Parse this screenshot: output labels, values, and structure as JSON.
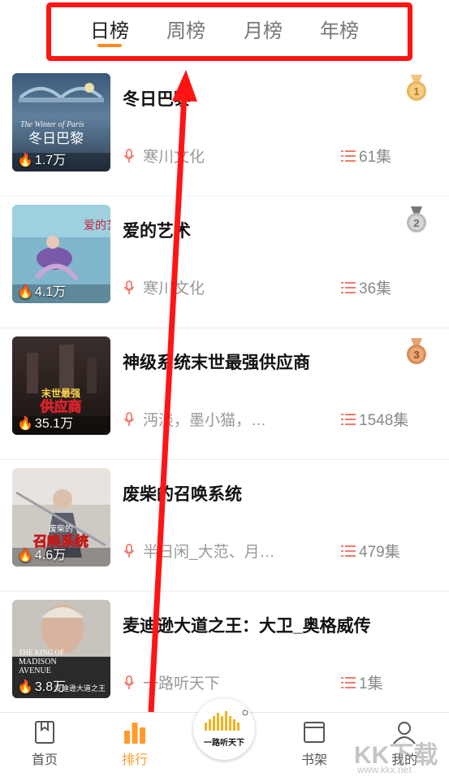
{
  "tabs": [
    {
      "label": "日榜",
      "active": true
    },
    {
      "label": "周榜",
      "active": false
    },
    {
      "label": "月榜",
      "active": false
    },
    {
      "label": "年榜",
      "active": false
    }
  ],
  "items": [
    {
      "title": "冬日巴黎",
      "author": "寒川文化",
      "episodes": "61集",
      "plays": "1.7万",
      "medal": "1",
      "cover_text": [
        "The Winter of Paris",
        "冬日巴黎"
      ]
    },
    {
      "title": "爱的艺术",
      "author": "寒川文化",
      "episodes": "36集",
      "plays": "4.1万",
      "medal": "2",
      "cover_text": [
        "爱的艺术"
      ]
    },
    {
      "title": "神级系统末世最强供应商",
      "author": "沔淡，墨小猫，…",
      "episodes": "1548集",
      "plays": "35.1万",
      "medal": "3",
      "cover_text": [
        "末世最强",
        "供应商"
      ]
    },
    {
      "title": "废柴的召唤系统",
      "author": "半日闲_大范、月…",
      "episodes": "479集",
      "plays": "4.6万",
      "medal": "",
      "cover_text": [
        "废柴的",
        "召唤系统"
      ]
    },
    {
      "title": "麦迪逊大道之王：大卫_奥格威传",
      "author": "一路听天下",
      "episodes": "1集",
      "plays": "3.8万",
      "medal": "",
      "cover_text": [
        "THE KING OF",
        "MADISON",
        "AVENUE",
        "麦迪逊大道之王"
      ]
    }
  ],
  "bottom_nav": {
    "home": "首页",
    "rank": "排行",
    "center_logo": "一路听天下",
    "shelf": "书架",
    "mine": "我的"
  },
  "watermark": {
    "big": "KK下载",
    "small": "www.kkx.net"
  },
  "colors": {
    "accent": "#ff8a1f",
    "annotation": "#ff1414",
    "gold": "#e9b45a",
    "silver": "#b9b9b9",
    "bronze": "#d98b52"
  },
  "icons": [
    "mic-icon",
    "episode-list-icon",
    "fire-icon",
    "medal-icon",
    "home-icon",
    "rank-icon",
    "shelf-icon",
    "profile-icon"
  ]
}
